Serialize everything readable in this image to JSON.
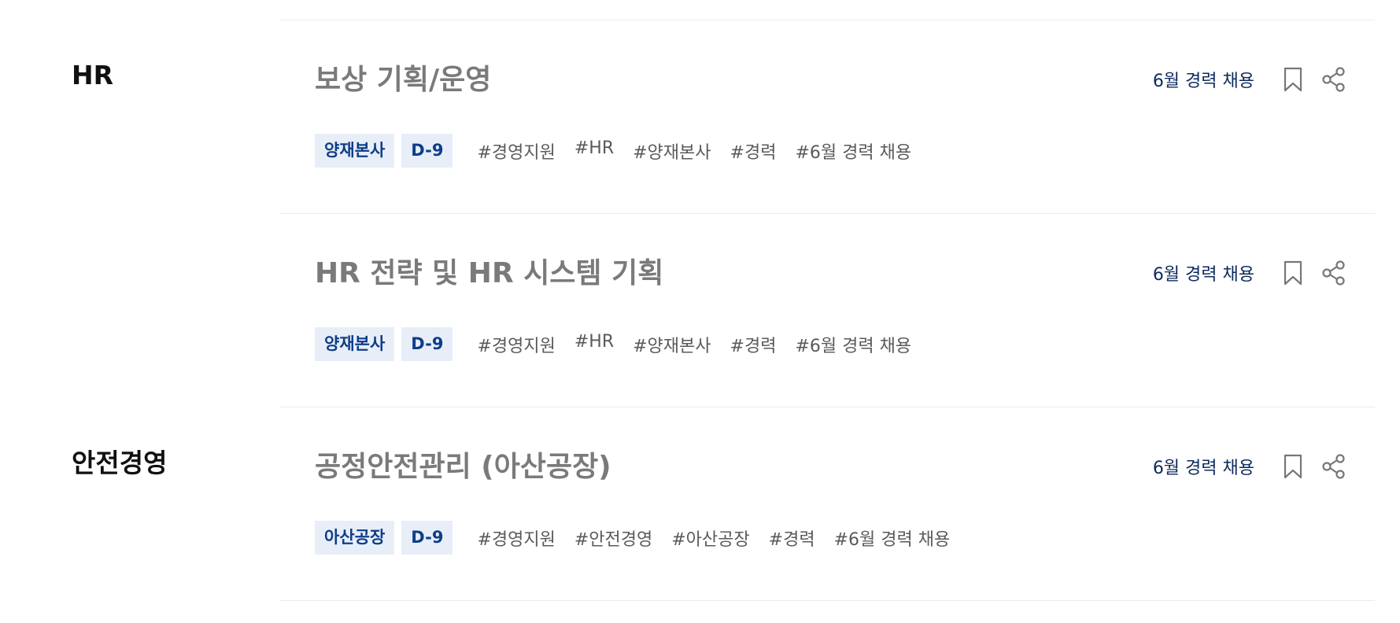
{
  "sections": [
    {
      "title": "HR"
    },
    {
      "title": "안전경영"
    }
  ],
  "jobs": [
    {
      "title": "보상 기획/운영",
      "recruit_label": "6월 경력 채용",
      "location": "양재본사",
      "dday": "D-9",
      "tags": [
        "#경영지원",
        "#HR",
        "#양재본사",
        "#경력",
        "#6월 경력 채용"
      ]
    },
    {
      "title": "HR 전략 및 HR 시스템 기획",
      "recruit_label": "6월 경력 채용",
      "location": "양재본사",
      "dday": "D-9",
      "tags": [
        "#경영지원",
        "#HR",
        "#양재본사",
        "#경력",
        "#6월 경력 채용"
      ]
    },
    {
      "title": "공정안전관리 (아산공장)",
      "recruit_label": "6월 경력 채용",
      "location": "아산공장",
      "dday": "D-9",
      "tags": [
        "#경영지원",
        "#안전경영",
        "#아산공장",
        "#경력",
        "#6월 경력 채용"
      ]
    }
  ],
  "icons": {
    "bookmark": "bookmark-icon",
    "share": "share-icon"
  },
  "colors": {
    "chip_bg": "#e8eef7",
    "chip_text": "#0d3d8a",
    "recruit_label": "#0d2a5c",
    "job_title": "#7a7a7a"
  }
}
